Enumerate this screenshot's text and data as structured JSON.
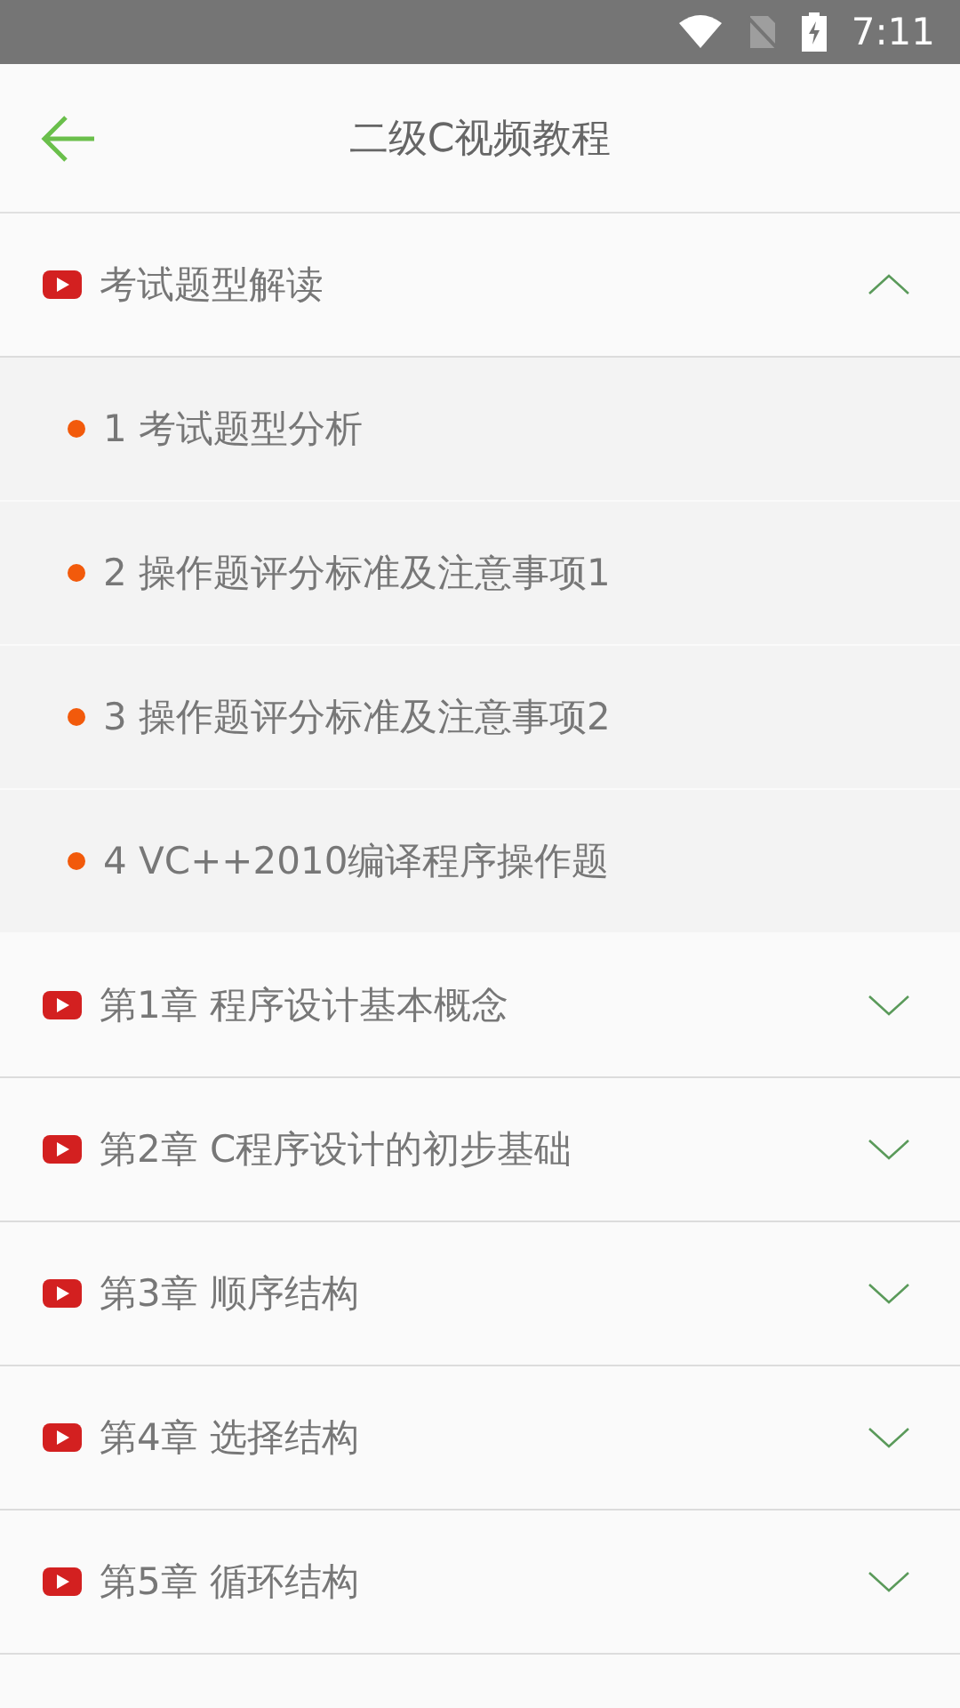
{
  "status_bar": {
    "time": "7:11"
  },
  "header": {
    "title": "二级C视频教程"
  },
  "sections": [
    {
      "title": "考试题型解读",
      "expanded": true,
      "items": [
        "1 考试题型分析",
        "2 操作题评分标准及注意事项1",
        "3 操作题评分标准及注意事项2",
        "4 VC++2010编译程序操作题"
      ]
    },
    {
      "title": "第1章 程序设计基本概念",
      "expanded": false
    },
    {
      "title": "第2章 C程序设计的初步基础",
      "expanded": false
    },
    {
      "title": "第3章 顺序结构",
      "expanded": false
    },
    {
      "title": "第4章 选择结构",
      "expanded": false
    },
    {
      "title": "第5章 循环结构",
      "expanded": false
    }
  ]
}
